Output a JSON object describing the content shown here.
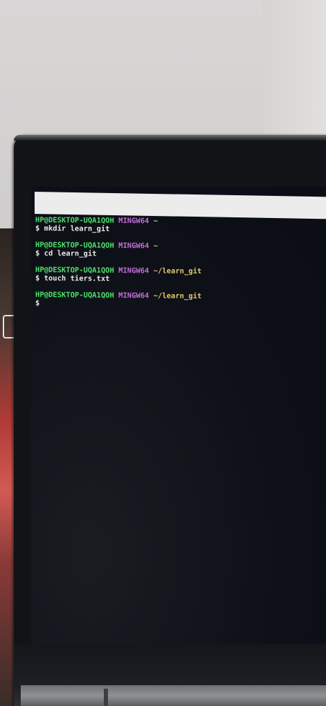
{
  "terminal": {
    "blocks": [
      {
        "user_host": "HP@DESKTOP-UQA1QOH",
        "system": "MINGW64",
        "path": "~",
        "command": "$ mkdir learn_git"
      },
      {
        "user_host": "HP@DESKTOP-UQA1QOH",
        "system": "MINGW64",
        "path": "~",
        "command": "$ cd learn_git"
      },
      {
        "user_host": "HP@DESKTOP-UQA1QOH",
        "system": "MINGW64",
        "path": "~/learn_git",
        "command": "$ touch tiers.txt"
      },
      {
        "user_host": "HP@DESKTOP-UQA1QOH",
        "system": "MINGW64",
        "path": "~/learn_git",
        "command": "$"
      }
    ]
  }
}
